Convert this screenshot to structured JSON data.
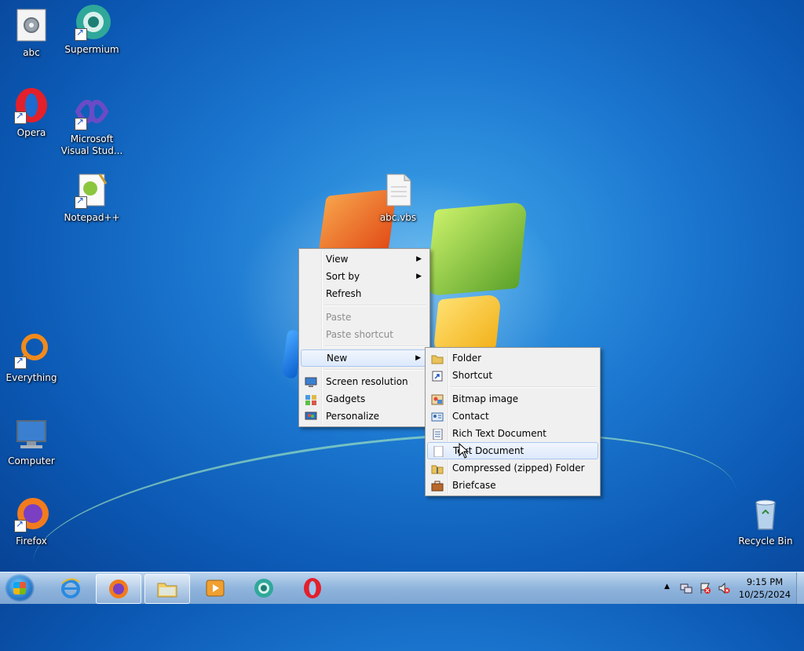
{
  "desktop": {
    "icons": [
      {
        "label": "abc"
      },
      {
        "label": "Supermium"
      },
      {
        "label": "Opera"
      },
      {
        "label": "Microsoft Visual Stud..."
      },
      {
        "label": "Notepad++"
      },
      {
        "label": "abc.vbs"
      },
      {
        "label": "Everything"
      },
      {
        "label": "Computer"
      },
      {
        "label": "Firefox"
      },
      {
        "label": "Recycle Bin"
      }
    ]
  },
  "context_menu": {
    "items": [
      {
        "label": "View"
      },
      {
        "label": "Sort by"
      },
      {
        "label": "Refresh"
      },
      {
        "label": "Paste"
      },
      {
        "label": "Paste shortcut"
      },
      {
        "label": "New"
      },
      {
        "label": "Screen resolution"
      },
      {
        "label": "Gadgets"
      },
      {
        "label": "Personalize"
      }
    ]
  },
  "new_submenu": {
    "items": [
      {
        "label": "Folder"
      },
      {
        "label": "Shortcut"
      },
      {
        "label": "Bitmap image"
      },
      {
        "label": "Contact"
      },
      {
        "label": "Rich Text Document"
      },
      {
        "label": "Text Document"
      },
      {
        "label": "Compressed (zipped) Folder"
      },
      {
        "label": "Briefcase"
      }
    ]
  },
  "taskbar": {
    "clock_time": "9:15 PM",
    "clock_date": "10/25/2024",
    "tray_expand": "▲"
  },
  "colors": {
    "taskbar": "#8fb4dc",
    "menu_bg": "#f0f0f0",
    "highlight_border": "#a9c6ec"
  }
}
